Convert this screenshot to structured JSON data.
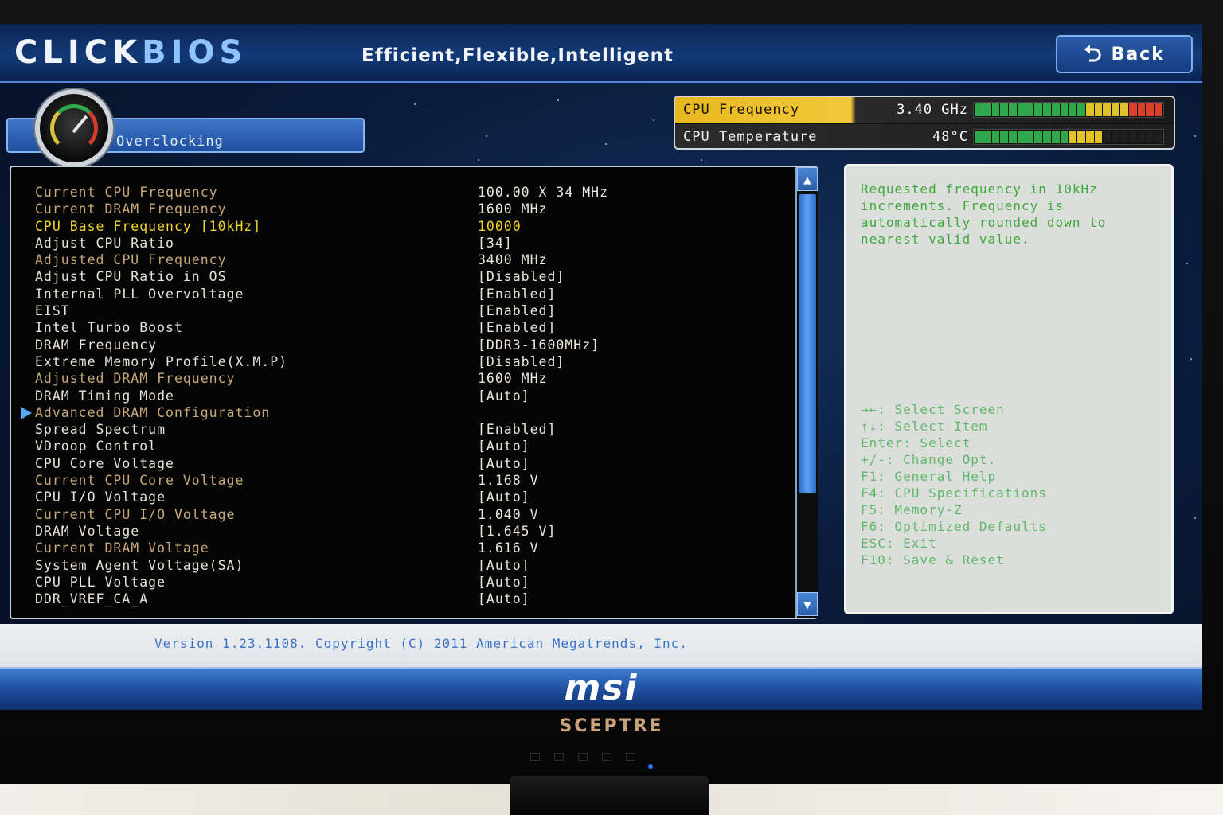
{
  "header": {
    "logo_click": "CLiCK",
    "logo_bios": "BiOS",
    "tagline": "Efficient,Flexible,Intelligent",
    "back_label": "Back"
  },
  "tab": {
    "label": "Overclocking"
  },
  "stats": {
    "cpu_frequency_label": "CPU Frequency",
    "cpu_frequency_value": "3.40 GHz",
    "cpu_frequency_level": 1.0,
    "cpu_temperature_label": "CPU Temperature",
    "cpu_temperature_value": "48°C",
    "cpu_temperature_level": 0.7
  },
  "settings": [
    {
      "label": "Current CPU Frequency",
      "value": "100.00 X 34 MHz",
      "kind": "info"
    },
    {
      "label": "Current DRAM Frequency",
      "value": "1600 MHz",
      "kind": "info"
    },
    {
      "label": "CPU Base Frequency [10kHz]",
      "value": "10000",
      "kind": "selected"
    },
    {
      "label": "Adjust CPU Ratio",
      "value": "[34]",
      "kind": "setting"
    },
    {
      "label": "Adjusted CPU Frequency",
      "value": "3400 MHz",
      "kind": "info"
    },
    {
      "label": "Adjust CPU Ratio in OS",
      "value": "[Disabled]",
      "kind": "setting"
    },
    {
      "label": "Internal PLL Overvoltage",
      "value": "[Enabled]",
      "kind": "setting"
    },
    {
      "label": "EIST",
      "value": "[Enabled]",
      "kind": "setting"
    },
    {
      "label": "Intel Turbo Boost",
      "value": "[Enabled]",
      "kind": "setting"
    },
    {
      "label": "DRAM Frequency",
      "value": "[DDR3-1600MHz]",
      "kind": "setting"
    },
    {
      "label": "Extreme Memory Profile(X.M.P)",
      "value": "[Disabled]",
      "kind": "setting"
    },
    {
      "label": "Adjusted DRAM Frequency",
      "value": "1600 MHz",
      "kind": "info"
    },
    {
      "label": "DRAM Timing Mode",
      "value": "[Auto]",
      "kind": "setting"
    },
    {
      "label": "Advanced DRAM Configuration",
      "value": "",
      "kind": "submenu"
    },
    {
      "label": "Spread Spectrum",
      "value": "[Enabled]",
      "kind": "setting"
    },
    {
      "label": "VDroop Control",
      "value": "[Auto]",
      "kind": "setting"
    },
    {
      "label": "CPU Core Voltage",
      "value": "[Auto]",
      "kind": "setting"
    },
    {
      "label": "Current CPU Core Voltage",
      "value": "1.168 V",
      "kind": "info"
    },
    {
      "label": "CPU I/O Voltage",
      "value": "[Auto]",
      "kind": "setting"
    },
    {
      "label": "Current CPU I/O Voltage",
      "value": "1.040 V",
      "kind": "info"
    },
    {
      "label": "DRAM Voltage",
      "value": "[1.645 V]",
      "kind": "setting"
    },
    {
      "label": "Current DRAM Voltage",
      "value": "1.616 V",
      "kind": "info"
    },
    {
      "label": "System Agent Voltage(SA)",
      "value": "[Auto]",
      "kind": "setting"
    },
    {
      "label": "CPU PLL Voltage",
      "value": "[Auto]",
      "kind": "setting"
    },
    {
      "label": "DDR_VREF_CA_A",
      "value": "[Auto]",
      "kind": "setting"
    }
  ],
  "help": {
    "text": "Requested frequency in 10kHz increments. Frequency is automatically rounded down to nearest valid value.",
    "keys": [
      "→←: Select Screen",
      "↑↓: Select Item",
      "Enter: Select",
      "+/-: Change Opt.",
      "F1: General Help",
      "F4: CPU Specifications",
      "F5: Memory-Z",
      "F6: Optimized Defaults",
      "ESC: Exit",
      "F10: Save & Reset"
    ]
  },
  "footer": {
    "version": "Version 1.23.1108. Copyright (C) 2011 American Megatrends, Inc.",
    "vendor": "msi"
  },
  "monitor": {
    "brand": "SCEPTRE"
  },
  "colors": {
    "accent_blue": "#2a5ea8",
    "selected_yellow": "#f2d32a",
    "help_green": "#3fa83c"
  }
}
